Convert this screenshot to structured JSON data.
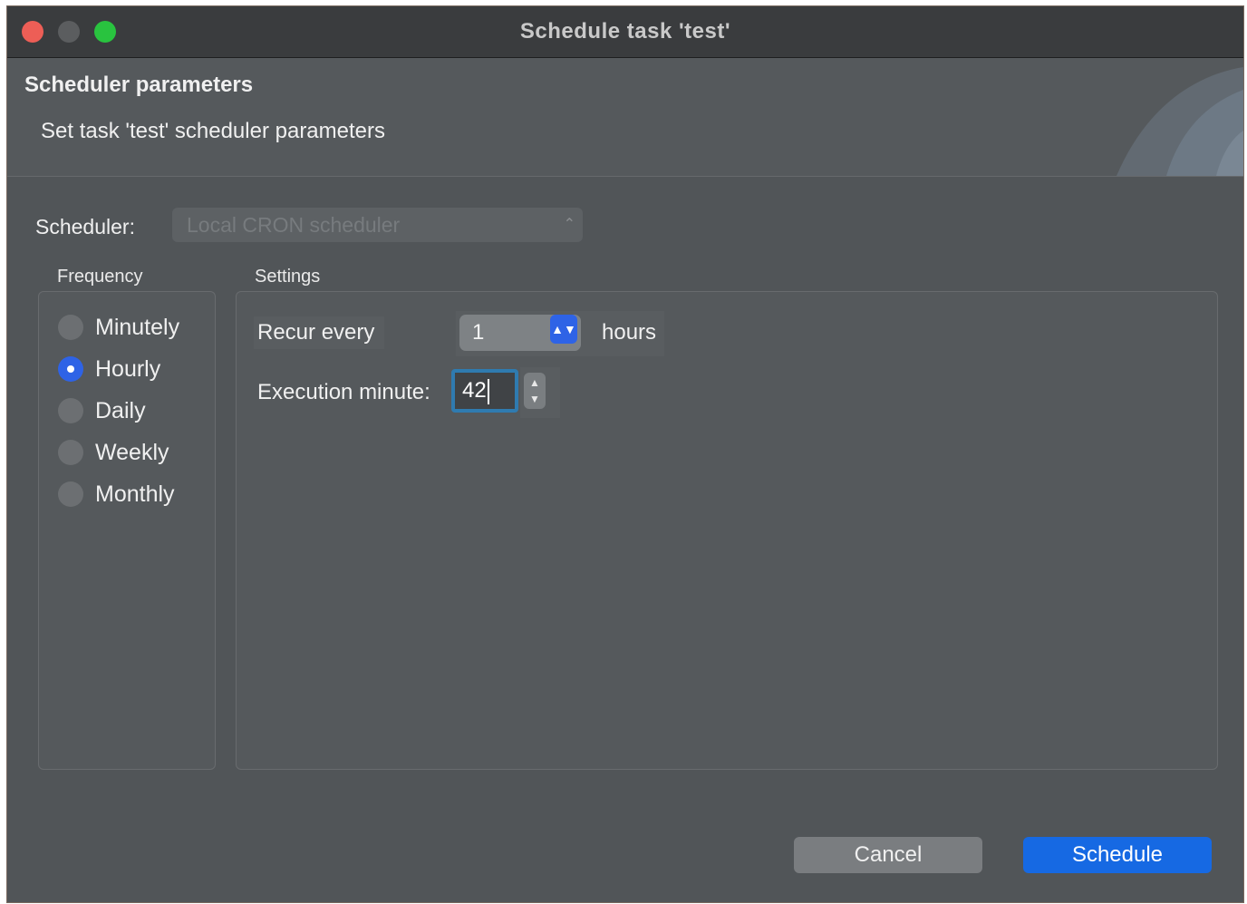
{
  "window": {
    "title": "Schedule task 'test'"
  },
  "banner": {
    "heading": "Scheduler parameters",
    "description": "Set task 'test' scheduler parameters"
  },
  "scheduler": {
    "label": "Scheduler:",
    "selected": "Local CRON scheduler",
    "enabled": false
  },
  "frequency": {
    "label": "Frequency",
    "options": [
      {
        "label": "Minutely",
        "checked": false
      },
      {
        "label": "Hourly",
        "checked": true
      },
      {
        "label": "Daily",
        "checked": false
      },
      {
        "label": "Weekly",
        "checked": false
      },
      {
        "label": "Monthly",
        "checked": false
      }
    ]
  },
  "settings": {
    "label": "Settings",
    "recur_label": "Recur every",
    "recur_value": "1",
    "recur_unit": "hours",
    "execution_label": "Execution minute:",
    "execution_value": "42"
  },
  "buttons": {
    "cancel": "Cancel",
    "schedule": "Schedule"
  },
  "colors": {
    "accent": "#2e63e6",
    "primary_button": "#1669e3",
    "focus_ring": "#2f7bb0",
    "window_bg": "#515558"
  },
  "icons": {
    "select_chevron": "up-down-chevron-icon",
    "stepper": "stepper-arrows-icon"
  }
}
